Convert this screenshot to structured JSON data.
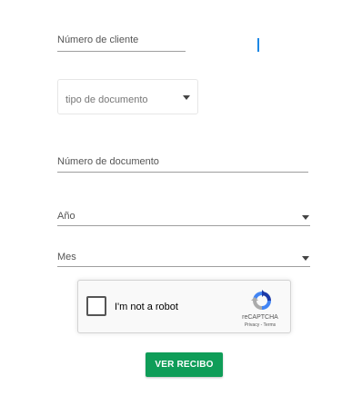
{
  "form": {
    "numero_cliente": {
      "label": "Número de cliente",
      "value": ""
    },
    "tipo_documento": {
      "placeholder": "tipo de documento",
      "icon": "chevron-down-icon"
    },
    "numero_documento": {
      "label": "Número de documento",
      "value": ""
    },
    "anio": {
      "label": "Año",
      "icon": "chevron-down-icon"
    },
    "mes": {
      "label": "Mes",
      "icon": "chevron-down-icon"
    }
  },
  "recaptcha": {
    "checkbox_label": "I'm not a robot",
    "brand": "reCAPTCHA",
    "links": "Privacy - Terms",
    "checked": false,
    "icon": "recaptcha-logo-icon"
  },
  "submit": {
    "label": "VER RECIBO",
    "color": "#0f9d58"
  },
  "colors": {
    "cursor": "#1e88e5",
    "underline": "#9e9e9e"
  }
}
